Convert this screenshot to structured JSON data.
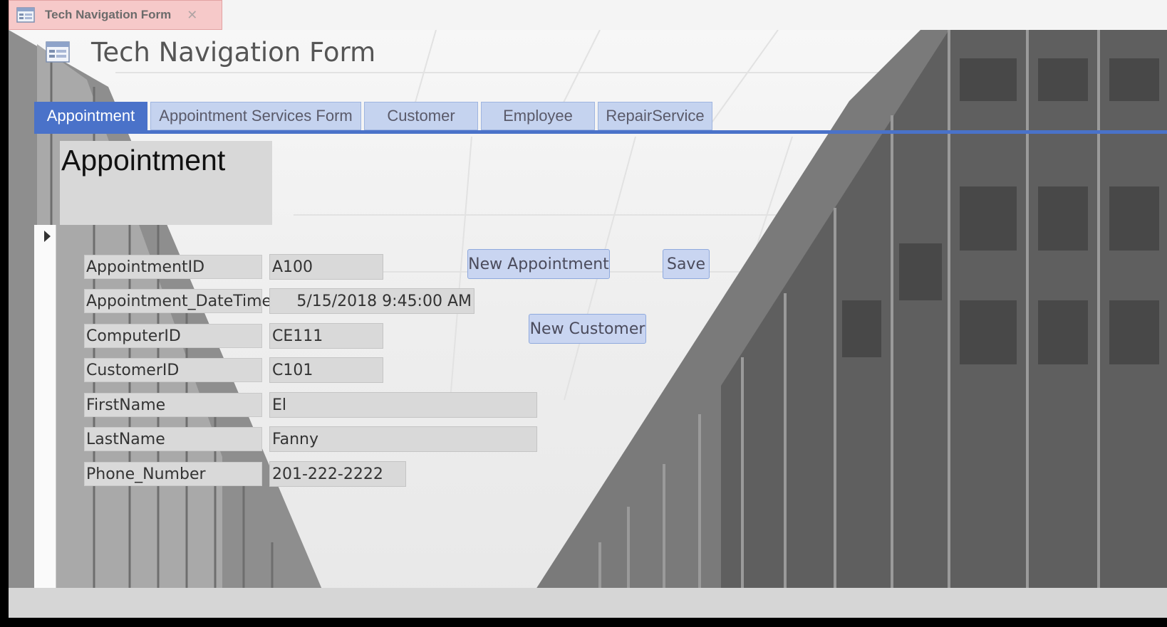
{
  "document_tab": {
    "label": "Tech Navigation Form",
    "icon": "form-icon",
    "close_icon": "close-icon"
  },
  "form": {
    "title": "Tech Navigation Form",
    "icon": "form-icon"
  },
  "nav_tabs": [
    {
      "label": "Appointment",
      "active": true
    },
    {
      "label": "Appointment Services Form",
      "active": false
    },
    {
      "label": "Customer",
      "active": false
    },
    {
      "label": "Employee",
      "active": false
    },
    {
      "label": "RepairService",
      "active": false
    }
  ],
  "subform": {
    "title": "Appointment",
    "record_selector_icon": "current-record-arrow-icon",
    "fields": [
      {
        "label": "AppointmentID",
        "value": "A100"
      },
      {
        "label": "Appointment_DateTime",
        "value": "5/15/2018 9:45:00 AM"
      },
      {
        "label": "ComputerID",
        "value": "CE111"
      },
      {
        "label": "CustomerID",
        "value": "C101"
      },
      {
        "label": "FirstName",
        "value": "El"
      },
      {
        "label": "LastName",
        "value": "Fanny"
      },
      {
        "label": "Phone_Number",
        "value": "201-222-2222"
      }
    ],
    "buttons": {
      "new_appointment": "New Appointment",
      "save": "Save",
      "new_customer": "New Customer"
    }
  },
  "colors": {
    "active_tab": "#4a72c9",
    "inactive_tab": "#c5d3ef",
    "doc_tab": "#f6c9c9",
    "button": "#c9d5f1",
    "field": "#d9d9d9"
  }
}
